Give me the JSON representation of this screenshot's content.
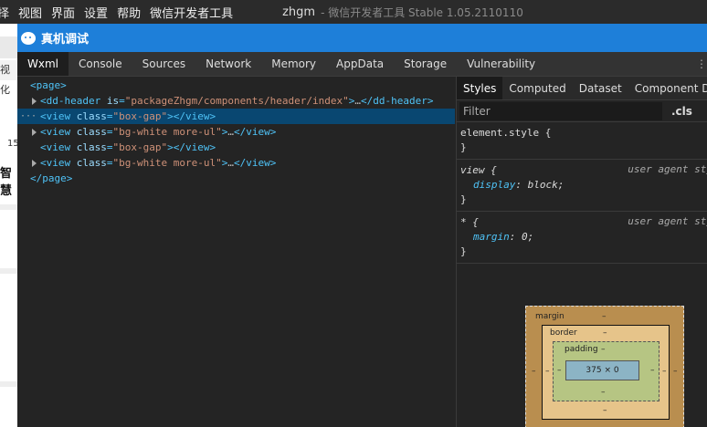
{
  "menubar": {
    "items": [
      "择",
      "视图",
      "界面",
      "设置",
      "帮助",
      "微信开发者工具"
    ],
    "app_title": "zhgm",
    "app_subtitle": "- 微信开发者工具 Stable 1.05.2110110"
  },
  "behind": {
    "t1": "视化",
    "t2": "15",
    "t3": "智慧"
  },
  "window": {
    "title": "真机调试"
  },
  "tabs": [
    "Wxml",
    "Console",
    "Sources",
    "Network",
    "Memory",
    "AppData",
    "Storage",
    "Vulnerability"
  ],
  "wxml": {
    "rows": [
      {
        "open": "<page>"
      },
      {
        "tag_open": "<dd-header",
        "attr": "is",
        "val": "\"packageZhgm/components/header/index\"",
        "close": ">",
        "ellipsis": "…",
        "end": "</dd-header>"
      },
      {
        "tag_open": "<view",
        "attr": "class",
        "val": "\"box-gap\"",
        "close": ">",
        "end": "</view>",
        "selected_marker": "···"
      },
      {
        "tag_open": "<view",
        "attr": "class",
        "val": "\"bg-white more-ul\"",
        "close": ">",
        "ellipsis": "…",
        "end": "</view>"
      },
      {
        "tag_open": "<view",
        "attr": "class",
        "val": "\"box-gap\"",
        "close": ">",
        "end": "</view>"
      },
      {
        "tag_open": "<view",
        "attr": "class",
        "val": "\"bg-white more-ul\"",
        "close": ">",
        "ellipsis": "…",
        "end": "</view>"
      },
      {
        "open": "</page>"
      }
    ]
  },
  "styles": {
    "subtabs": [
      "Styles",
      "Computed",
      "Dataset",
      "Component Da"
    ],
    "filter_placeholder": "Filter",
    "cls": ".cls",
    "element_style": "element.style {",
    "close_brace": "}",
    "rule1": {
      "selector": "view {",
      "source": "user agent sty",
      "prop": "display",
      "value": "block;"
    },
    "rule2": {
      "selector": "* {",
      "source": "user agent sty",
      "prop": "margin",
      "value": "0;"
    }
  },
  "boxmodel": {
    "margin_label": "margin",
    "border_label": "border",
    "padding_label": "padding",
    "content": "375 × 0",
    "dash": "–"
  },
  "colors": {
    "titlebar": "#1e7fd9",
    "selection": "#094771"
  }
}
